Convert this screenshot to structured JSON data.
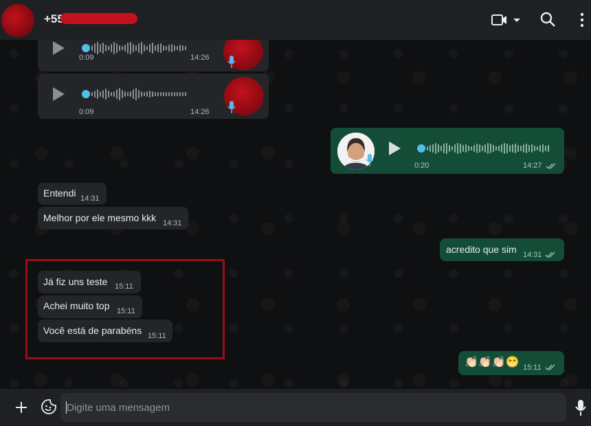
{
  "header": {
    "contact_name": "+55",
    "icons": [
      "video-call-icon",
      "chevron-down-icon",
      "search-icon",
      "menu-icon"
    ]
  },
  "messages": {
    "audio_in_1": {
      "duration": "0:09",
      "time": "14:26"
    },
    "audio_in_2": {
      "duration": "0:09",
      "time": "14:26"
    },
    "audio_out_1": {
      "duration": "0:20",
      "time": "14:27"
    },
    "in_1": {
      "text": "Entendi",
      "time": "14:31"
    },
    "in_2": {
      "text": "Melhor por ele mesmo kkk",
      "time": "14:31"
    },
    "out_1": {
      "text": "acredito que sim",
      "time": "14:31"
    },
    "in_3": {
      "text": "Já fiz uns teste",
      "time": "15:11"
    },
    "in_4": {
      "text": "Achei muito top",
      "time": "15:11"
    },
    "in_5": {
      "text": "Você está de parabéns",
      "time": "15:11"
    },
    "out_2": {
      "text": "👏🏻👏🏻👏🏻😁",
      "time": "15:11"
    }
  },
  "composer": {
    "placeholder": "Digite uma mensagem",
    "icons": [
      "plus-icon",
      "sticker-icon",
      "mic-icon"
    ]
  },
  "colors": {
    "header_bg": "#1f2023",
    "incoming_bubble": "#232528",
    "outgoing_bubble": "#144d37",
    "accent_blue": "#53bdeb",
    "highlight_border": "#9b0d19"
  }
}
